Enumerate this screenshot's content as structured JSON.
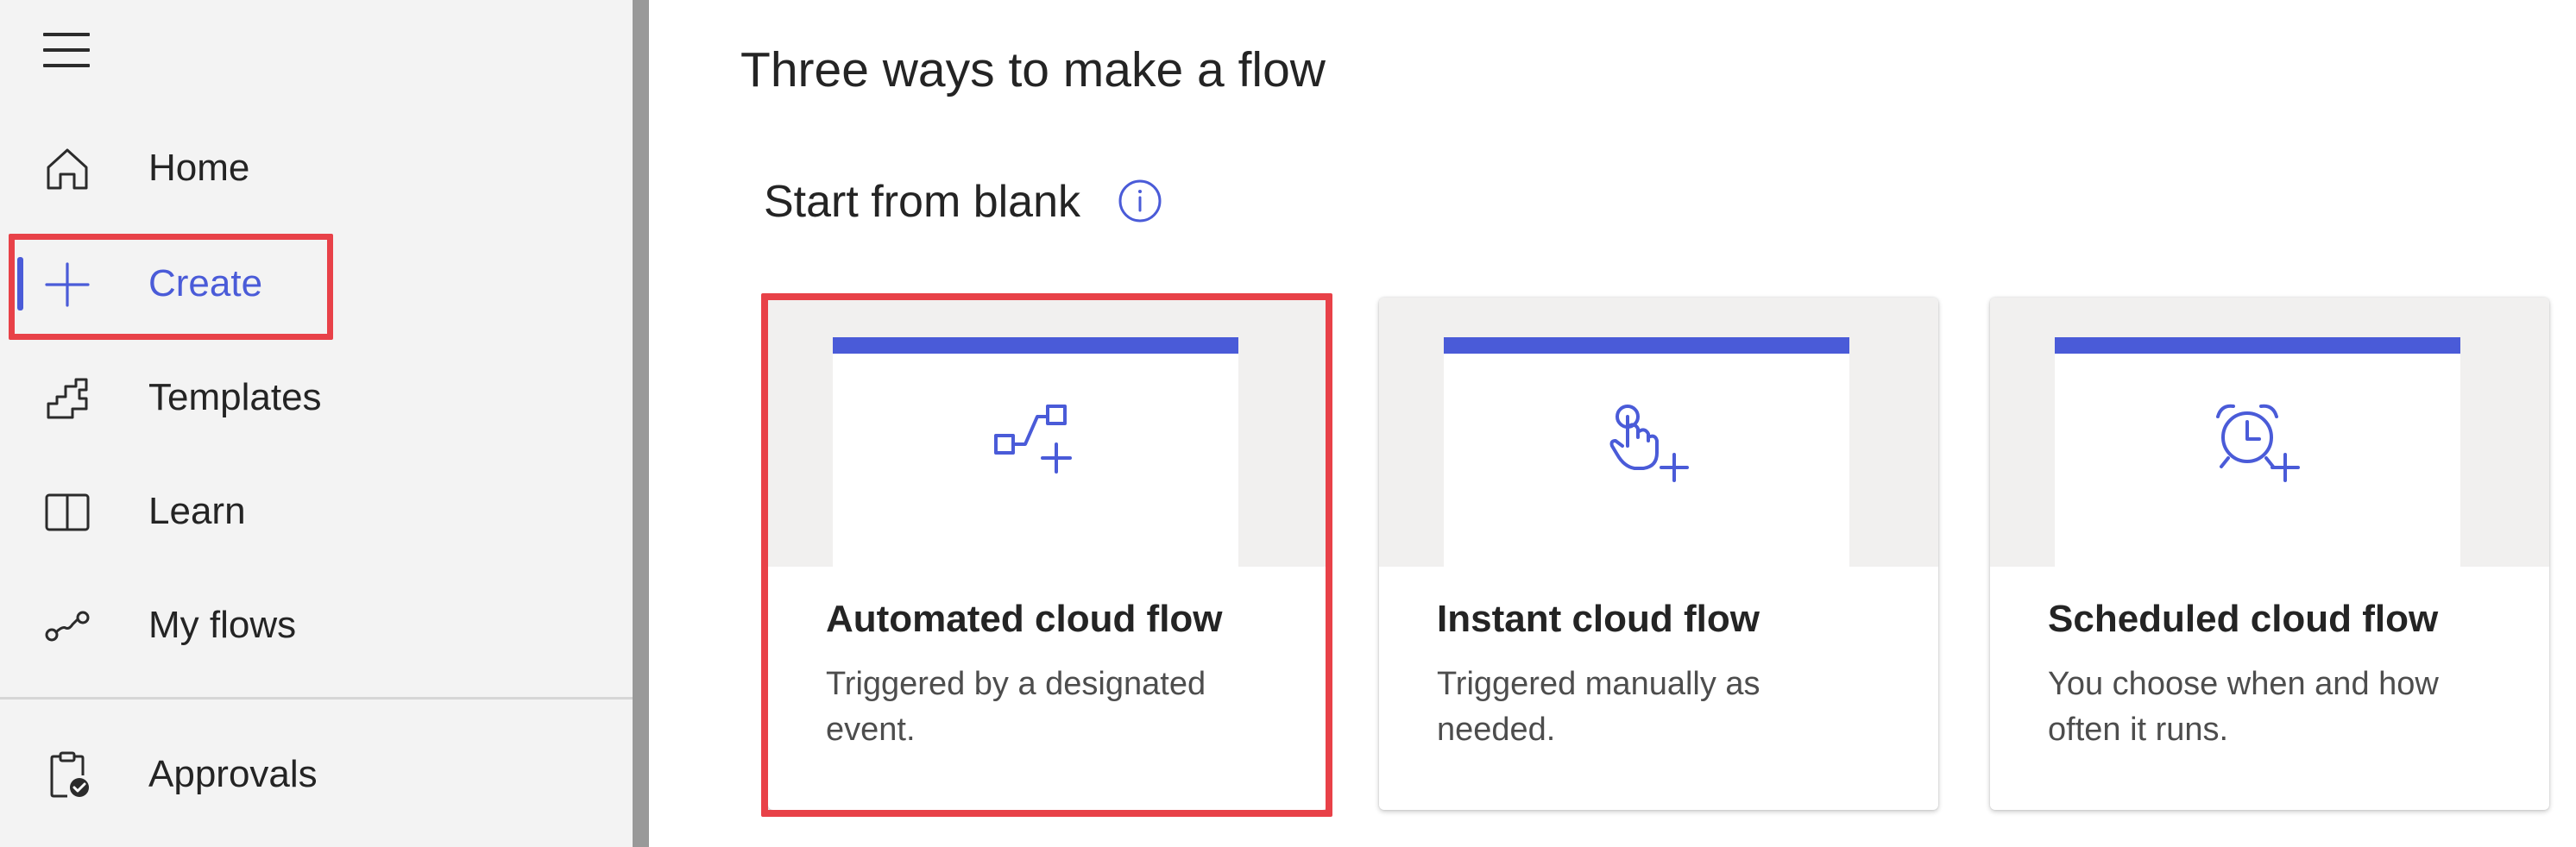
{
  "sidebar": {
    "items": [
      {
        "label": "Home",
        "icon": "home-icon"
      },
      {
        "label": "Create",
        "icon": "plus-icon",
        "active": true
      },
      {
        "label": "Templates",
        "icon": "templates-icon"
      },
      {
        "label": "Learn",
        "icon": "book-icon"
      },
      {
        "label": "My flows",
        "icon": "flow-icon"
      },
      {
        "label": "Approvals",
        "icon": "approvals-icon"
      }
    ]
  },
  "main": {
    "title": "Three ways to make a flow",
    "section": {
      "title": "Start from blank",
      "info_icon": "info-icon"
    },
    "cards": [
      {
        "title": "Automated cloud flow",
        "description": "Triggered by a designated event.",
        "icon": "automated-flow-icon"
      },
      {
        "title": "Instant cloud flow",
        "description": "Triggered manually as needed.",
        "icon": "instant-flow-icon"
      },
      {
        "title": "Scheduled cloud flow",
        "description": "You choose when and how often it runs.",
        "icon": "scheduled-flow-icon"
      }
    ]
  },
  "colors": {
    "accent": "#4a5bd8",
    "highlight": "#e84148",
    "sidebar_bg": "#f3f3f3"
  }
}
